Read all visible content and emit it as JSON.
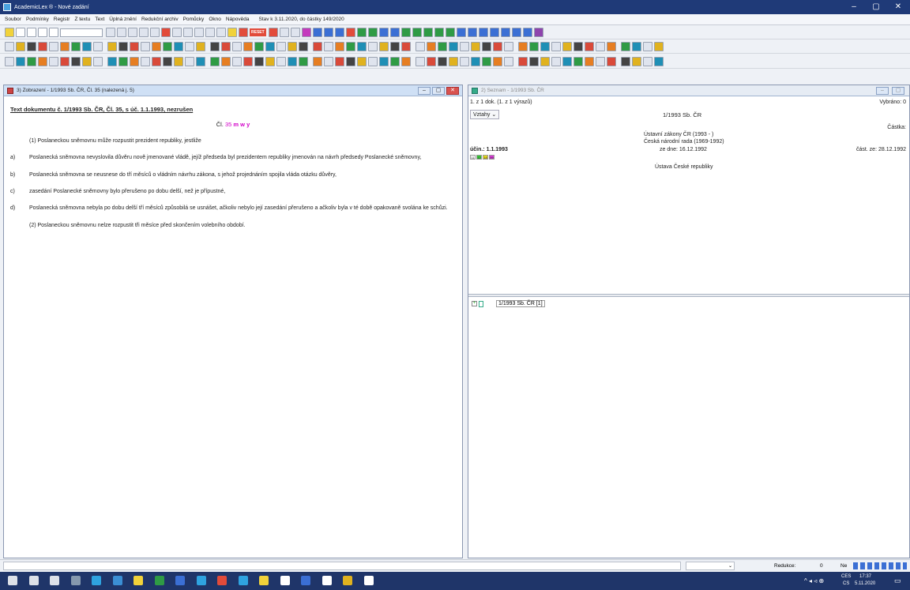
{
  "window": {
    "title": "AcademicLex ® - Nové zadání",
    "minimize": "–",
    "maximize": "▢",
    "close": "✕"
  },
  "menu": {
    "items": [
      "Soubor",
      "Podmínky",
      "Registr",
      "Z textu",
      "Text",
      "Úplná znění",
      "Redukční archiv",
      "Pomůcky",
      "Okno",
      "Nápověda"
    ],
    "state": "Stav k 3.11.2020, do částky 149/2020"
  },
  "toolbar": {
    "reset_label": "RESET",
    "combo_value": "",
    "colors": [
      "#3b6fd4",
      "#d94a3a",
      "#2f9b45",
      "#e0b21f",
      "#8e44ad",
      "#1f8fb5",
      "#444",
      "#e67e22"
    ]
  },
  "left_pane": {
    "title": "3) Zobrazení - 1/1993 Sb. ČR, Čl. 35 (nalezená j. 5)",
    "heading": "Text dokumentu č. 1/1993 Sb. ČR, Čl. 35, s úč. 1.1.1993, nezrušen",
    "article_prefix": "Čl.",
    "article_number": "35",
    "article_tags": "m w y",
    "para1": "(1) Poslaneckou sněmovnu může rozpustit prezident republiky, jestliže",
    "items": [
      {
        "label": "a)",
        "text": "Poslanecká sněmovna nevyslovila důvěru nově jmenované vládě, jejíž předseda byl prezidentem republiky jmenován na návrh předsedy Poslanecké sněmovny,"
      },
      {
        "label": "b)",
        "text": "Poslanecká sněmovna se neusnese do tří měsíců o vládním návrhu zákona, s jehož projednáním spojila vláda otázku důvěry,"
      },
      {
        "label": "c)",
        "text": "zasedání Poslanecké sněmovny bylo přerušeno po dobu delší, než je přípustné,"
      },
      {
        "label": "d)",
        "text": "Poslanecká sněmovna nebyla po dobu delší tří měsíců způsobilá se usnášet, ačkoliv nebylo její zasedání přerušeno a ačkoliv byla v té době opakovaně svolána ke schůzi."
      }
    ],
    "para2": "(2) Poslaneckou sněmovnu nelze rozpustit tři měsíce před skončením volebního období."
  },
  "right_pane": {
    "title": "2) Seznam - 1/1993 Sb. ČR",
    "count": "1. z 1 dok. (1. z 1 výrazů)",
    "vybrano": "Vybráno: 0",
    "vztahy": "Vztahy",
    "doc_id": "1/1993 Sb. ČR",
    "castka": "Částka:",
    "group": "Ústavní zákony ČR (1993 - )",
    "issuer": "Česká národní rada (1969-1992)",
    "effective": "účin.: 1.1.1993",
    "date": "ze dne: 16.12.1992",
    "cast_date": "část. ze: 28.12.1992",
    "subject": "Ústava České republiky",
    "tags": [
      {
        "label": "11",
        "color": "#ffffff"
      },
      {
        "label": "12",
        "color": "#3ad13a"
      },
      {
        "label": "18",
        "color": "#f1e21a"
      },
      {
        "label": "99",
        "color": "#e23ae0"
      }
    ],
    "tree_item": "1/1993 Sb. ČR [1]"
  },
  "status": {
    "redukce_label": "Redukce:",
    "redukce_value": "0",
    "ne_label": "Ne"
  },
  "tray": {
    "lang": "CES",
    "lang2": "CS",
    "time": "17:37",
    "date": "5.11.2020"
  }
}
